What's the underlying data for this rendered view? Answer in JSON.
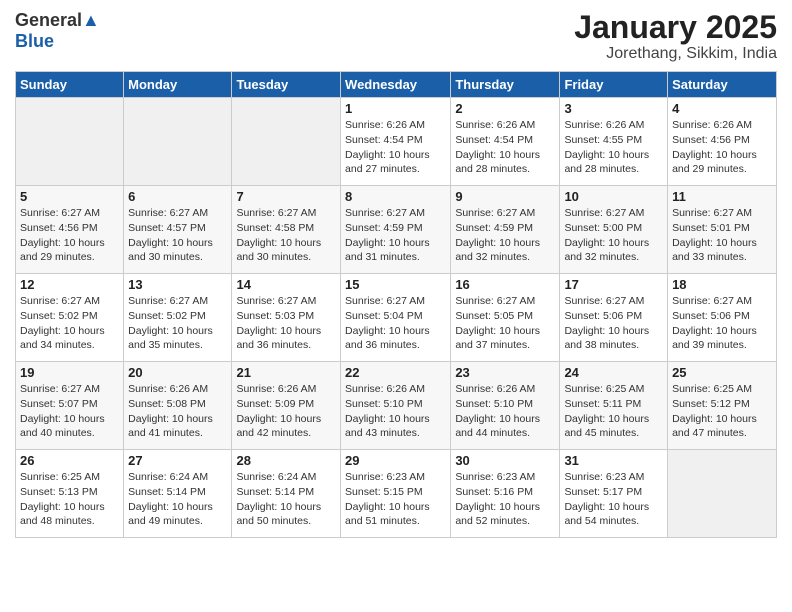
{
  "header": {
    "logo_general": "General",
    "logo_blue": "Blue",
    "title": "January 2025",
    "subtitle": "Jorethang, Sikkim, India"
  },
  "weekdays": [
    "Sunday",
    "Monday",
    "Tuesday",
    "Wednesday",
    "Thursday",
    "Friday",
    "Saturday"
  ],
  "weeks": [
    [
      {
        "day": "",
        "sunrise": "",
        "sunset": "",
        "daylight": ""
      },
      {
        "day": "",
        "sunrise": "",
        "sunset": "",
        "daylight": ""
      },
      {
        "day": "",
        "sunrise": "",
        "sunset": "",
        "daylight": ""
      },
      {
        "day": "1",
        "sunrise": "Sunrise: 6:26 AM",
        "sunset": "Sunset: 4:54 PM",
        "daylight": "Daylight: 10 hours and 27 minutes."
      },
      {
        "day": "2",
        "sunrise": "Sunrise: 6:26 AM",
        "sunset": "Sunset: 4:54 PM",
        "daylight": "Daylight: 10 hours and 28 minutes."
      },
      {
        "day": "3",
        "sunrise": "Sunrise: 6:26 AM",
        "sunset": "Sunset: 4:55 PM",
        "daylight": "Daylight: 10 hours and 28 minutes."
      },
      {
        "day": "4",
        "sunrise": "Sunrise: 6:26 AM",
        "sunset": "Sunset: 4:56 PM",
        "daylight": "Daylight: 10 hours and 29 minutes."
      }
    ],
    [
      {
        "day": "5",
        "sunrise": "Sunrise: 6:27 AM",
        "sunset": "Sunset: 4:56 PM",
        "daylight": "Daylight: 10 hours and 29 minutes."
      },
      {
        "day": "6",
        "sunrise": "Sunrise: 6:27 AM",
        "sunset": "Sunset: 4:57 PM",
        "daylight": "Daylight: 10 hours and 30 minutes."
      },
      {
        "day": "7",
        "sunrise": "Sunrise: 6:27 AM",
        "sunset": "Sunset: 4:58 PM",
        "daylight": "Daylight: 10 hours and 30 minutes."
      },
      {
        "day": "8",
        "sunrise": "Sunrise: 6:27 AM",
        "sunset": "Sunset: 4:59 PM",
        "daylight": "Daylight: 10 hours and 31 minutes."
      },
      {
        "day": "9",
        "sunrise": "Sunrise: 6:27 AM",
        "sunset": "Sunset: 4:59 PM",
        "daylight": "Daylight: 10 hours and 32 minutes."
      },
      {
        "day": "10",
        "sunrise": "Sunrise: 6:27 AM",
        "sunset": "Sunset: 5:00 PM",
        "daylight": "Daylight: 10 hours and 32 minutes."
      },
      {
        "day": "11",
        "sunrise": "Sunrise: 6:27 AM",
        "sunset": "Sunset: 5:01 PM",
        "daylight": "Daylight: 10 hours and 33 minutes."
      }
    ],
    [
      {
        "day": "12",
        "sunrise": "Sunrise: 6:27 AM",
        "sunset": "Sunset: 5:02 PM",
        "daylight": "Daylight: 10 hours and 34 minutes."
      },
      {
        "day": "13",
        "sunrise": "Sunrise: 6:27 AM",
        "sunset": "Sunset: 5:02 PM",
        "daylight": "Daylight: 10 hours and 35 minutes."
      },
      {
        "day": "14",
        "sunrise": "Sunrise: 6:27 AM",
        "sunset": "Sunset: 5:03 PM",
        "daylight": "Daylight: 10 hours and 36 minutes."
      },
      {
        "day": "15",
        "sunrise": "Sunrise: 6:27 AM",
        "sunset": "Sunset: 5:04 PM",
        "daylight": "Daylight: 10 hours and 36 minutes."
      },
      {
        "day": "16",
        "sunrise": "Sunrise: 6:27 AM",
        "sunset": "Sunset: 5:05 PM",
        "daylight": "Daylight: 10 hours and 37 minutes."
      },
      {
        "day": "17",
        "sunrise": "Sunrise: 6:27 AM",
        "sunset": "Sunset: 5:06 PM",
        "daylight": "Daylight: 10 hours and 38 minutes."
      },
      {
        "day": "18",
        "sunrise": "Sunrise: 6:27 AM",
        "sunset": "Sunset: 5:06 PM",
        "daylight": "Daylight: 10 hours and 39 minutes."
      }
    ],
    [
      {
        "day": "19",
        "sunrise": "Sunrise: 6:27 AM",
        "sunset": "Sunset: 5:07 PM",
        "daylight": "Daylight: 10 hours and 40 minutes."
      },
      {
        "day": "20",
        "sunrise": "Sunrise: 6:26 AM",
        "sunset": "Sunset: 5:08 PM",
        "daylight": "Daylight: 10 hours and 41 minutes."
      },
      {
        "day": "21",
        "sunrise": "Sunrise: 6:26 AM",
        "sunset": "Sunset: 5:09 PM",
        "daylight": "Daylight: 10 hours and 42 minutes."
      },
      {
        "day": "22",
        "sunrise": "Sunrise: 6:26 AM",
        "sunset": "Sunset: 5:10 PM",
        "daylight": "Daylight: 10 hours and 43 minutes."
      },
      {
        "day": "23",
        "sunrise": "Sunrise: 6:26 AM",
        "sunset": "Sunset: 5:10 PM",
        "daylight": "Daylight: 10 hours and 44 minutes."
      },
      {
        "day": "24",
        "sunrise": "Sunrise: 6:25 AM",
        "sunset": "Sunset: 5:11 PM",
        "daylight": "Daylight: 10 hours and 45 minutes."
      },
      {
        "day": "25",
        "sunrise": "Sunrise: 6:25 AM",
        "sunset": "Sunset: 5:12 PM",
        "daylight": "Daylight: 10 hours and 47 minutes."
      }
    ],
    [
      {
        "day": "26",
        "sunrise": "Sunrise: 6:25 AM",
        "sunset": "Sunset: 5:13 PM",
        "daylight": "Daylight: 10 hours and 48 minutes."
      },
      {
        "day": "27",
        "sunrise": "Sunrise: 6:24 AM",
        "sunset": "Sunset: 5:14 PM",
        "daylight": "Daylight: 10 hours and 49 minutes."
      },
      {
        "day": "28",
        "sunrise": "Sunrise: 6:24 AM",
        "sunset": "Sunset: 5:14 PM",
        "daylight": "Daylight: 10 hours and 50 minutes."
      },
      {
        "day": "29",
        "sunrise": "Sunrise: 6:23 AM",
        "sunset": "Sunset: 5:15 PM",
        "daylight": "Daylight: 10 hours and 51 minutes."
      },
      {
        "day": "30",
        "sunrise": "Sunrise: 6:23 AM",
        "sunset": "Sunset: 5:16 PM",
        "daylight": "Daylight: 10 hours and 52 minutes."
      },
      {
        "day": "31",
        "sunrise": "Sunrise: 6:23 AM",
        "sunset": "Sunset: 5:17 PM",
        "daylight": "Daylight: 10 hours and 54 minutes."
      },
      {
        "day": "",
        "sunrise": "",
        "sunset": "",
        "daylight": ""
      }
    ]
  ]
}
